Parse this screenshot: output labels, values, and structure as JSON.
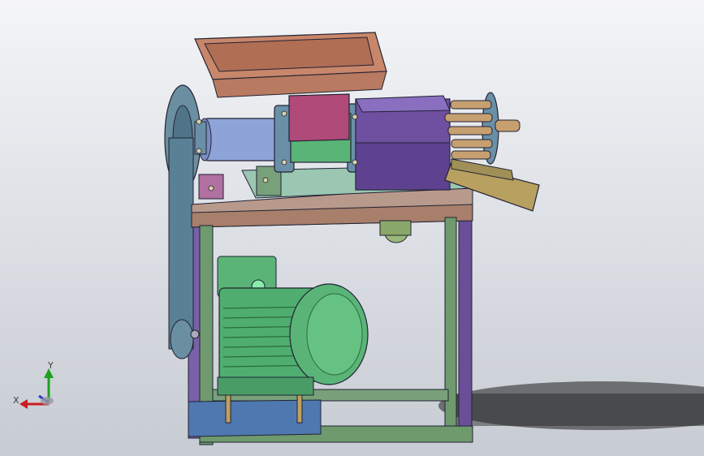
{
  "viewport": {
    "background_top": "#f4f5f7",
    "background_bottom": "#c7cbd3"
  },
  "triad": {
    "x_label": "X",
    "y_label": "Y",
    "x_color": "#c81e1e",
    "y_color": "#1ea01e",
    "z_color": "#1e3cc8"
  },
  "parts": [
    {
      "name": "hopper",
      "color": "#c8866a"
    },
    {
      "name": "feed-throat",
      "color": "#b04a78"
    },
    {
      "name": "bearing-housing",
      "color": "#8ea4d8"
    },
    {
      "name": "flange",
      "color": "#6a90a8"
    },
    {
      "name": "barrel-housing",
      "color": "#6e4fa0"
    },
    {
      "name": "die-rods",
      "color": "#c6a070"
    },
    {
      "name": "discharge-chute",
      "color": "#b8a060"
    },
    {
      "name": "frame-top-plate",
      "color": "#b89a8c"
    },
    {
      "name": "frame-legs",
      "color": "#6e9a6e"
    },
    {
      "name": "side-panel",
      "color": "#7a5fa6"
    },
    {
      "name": "belt-pulley",
      "color": "#5f8fa8"
    },
    {
      "name": "electric-motor",
      "color": "#5ab477"
    },
    {
      "name": "motor-base-plate",
      "color": "#4f78b0"
    },
    {
      "name": "outlet-pipe",
      "color": "#9ab87a"
    }
  ]
}
